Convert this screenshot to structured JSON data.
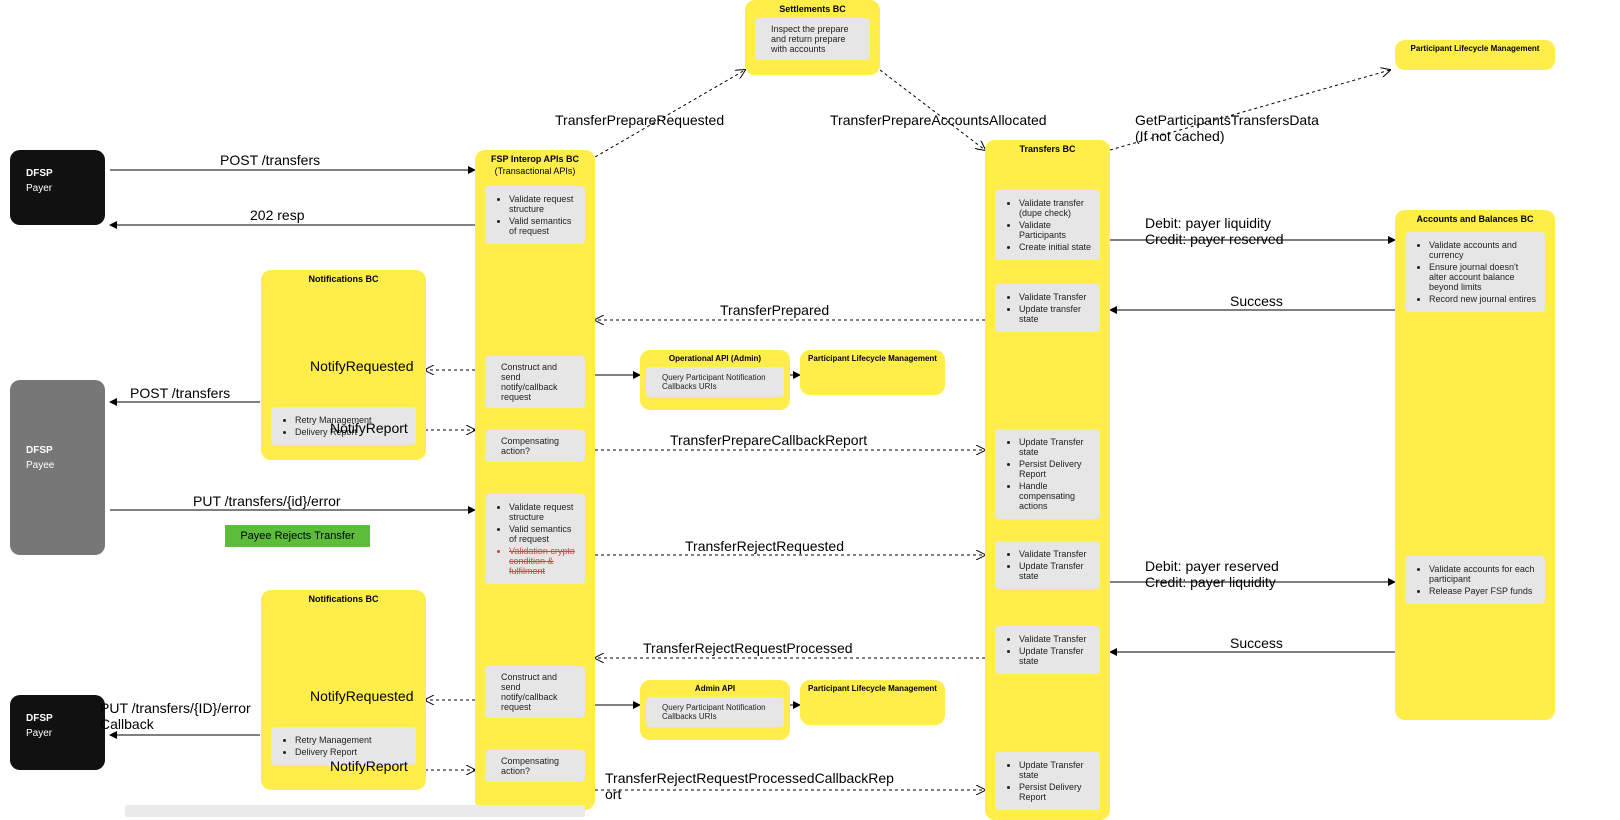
{
  "nodes": {
    "settlements": {
      "title": "Settlements BC",
      "desc": "Inspect the prepare and return prepare with accounts"
    },
    "fsp": {
      "title": "FSP Interop APIs BC",
      "subtitle": "(Transactional APIs)",
      "p1_a": "Validate request structure",
      "p1_b": "Valid semantics of request",
      "p2": "Construct and send notify/callback request",
      "p3": "Compensating action?",
      "p4_a": "Validate request structure",
      "p4_b": "Valid semantics of request",
      "p4_c": "Validation crypto condition & fulfilment",
      "p5": "Construct and send notify/callback request",
      "p6": "Compensating action?"
    },
    "transfers": {
      "title": "Transfers BC",
      "p1_a": "Validate transfer (dupe check)",
      "p1_b": "Validate Participants",
      "p1_c": "Create initial state",
      "p2_a": "Validate Transfer",
      "p2_b": "Update transfer state",
      "p3_a": "Update Transfer state",
      "p3_b": "Persist Delivery Report",
      "p3_c": "Handle compensating actions",
      "p4_a": "Validate Transfer",
      "p4_b": "Update Transfer state",
      "p5_a": "Validate Transfer",
      "p5_b": "Update Transfer state",
      "p6_a": "Update Transfer state",
      "p6_b": "Persist Delivery Report"
    },
    "accounts": {
      "title": "Accounts and Balances BC",
      "p1_a": "Validate accounts and currency",
      "p1_b": "Ensure journal doesn't alter account balance beyond limits",
      "p1_c": "Record new journal entires",
      "p2_a": "Validate accounts for each participant",
      "p2_b": "Release Payer FSP funds"
    },
    "plm_tiny": {
      "title": "Participant Lifecycle Management"
    },
    "notif1": {
      "title": "Notifications BC",
      "p_a": "Retry Management",
      "p_b": "Delivery Report"
    },
    "notif2": {
      "title": "Notifications BC",
      "p_a": "Retry Management",
      "p_b": "Delivery Report"
    },
    "opapi1": {
      "title": "Operational API (Admin)",
      "p": "Query Participant Notification Callbacks URIs"
    },
    "opapi2": {
      "title": "Admin API",
      "p": "Query Participant Notification Callbacks URIs"
    },
    "plm1": {
      "title": "Participant Lifecycle Management"
    },
    "plm2": {
      "title": "Participant Lifecycle Management"
    },
    "payer1": {
      "t": "DFSP",
      "s": "Payer"
    },
    "payee": {
      "t": "DFSP",
      "s": "Payee"
    },
    "payer2": {
      "t": "DFSP",
      "s": "Payer"
    },
    "green": {
      "t": "Payee Rejects Transfer"
    }
  },
  "labels": {
    "l1": "POST /transfers",
    "l2": "202 resp",
    "l3": "TransferPrepareRequested",
    "l4": "TransferPrepareAccountsAllocated",
    "l5": "GetParticipantsTransfersData\n(If not cached)",
    "l6": "Debit: payer liquidity\nCredit: payer reserved",
    "l7": "Success",
    "l8": "TransferPrepared",
    "l9": "TransferPrepareCallbackReport",
    "l10": "NotifyRequested",
    "l11": "NotifyReport",
    "l12": "POST /transfers",
    "l13": "PUT /transfers/{id}/error",
    "l14": "TransferRejectRequested",
    "l15": "Debit: payer reserved\nCredit: payer liquidity",
    "l16": "Success",
    "l17": "TransferRejectRequestProcessed",
    "l18": "NotifyRequested",
    "l19": "NotifyReport",
    "l20": "PUT /transfers/{ID}/error\nCallback",
    "l21": "TransferRejectRequestProcessedCallbackRep\nort"
  }
}
